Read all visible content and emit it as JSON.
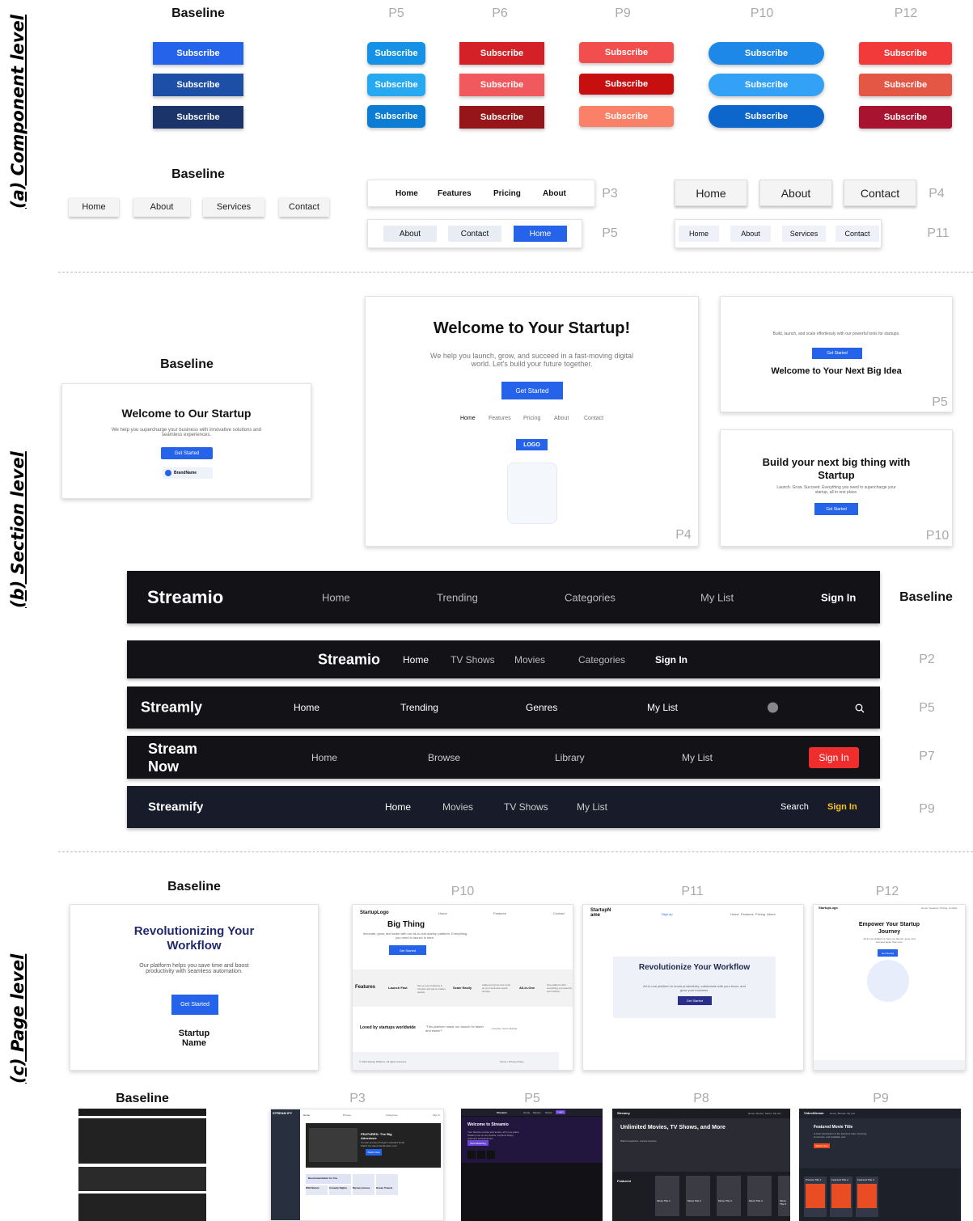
{
  "sections": {
    "a": "(a) Component level",
    "b": "(b) Section level",
    "c": "(c) Page level"
  },
  "a": {
    "buttons": {
      "headers": [
        "Baseline",
        "P5",
        "P6",
        "P9",
        "P10",
        "P12"
      ],
      "label": "Subscribe",
      "colors": {
        "baseline": [
          "#2563eb",
          "#1e4fa6",
          "#1b356b"
        ],
        "p5": [
          "#1592e6",
          "#27a9f2",
          "#0d7dd4"
        ],
        "p6": [
          "#d42128",
          "#f05a5f",
          "#951519"
        ],
        "p9": [
          "#f24e4e",
          "#c80f0f",
          "#fb8068"
        ],
        "p10": [
          "#1e88e8",
          "#33a1f5",
          "#0d66cc"
        ],
        "p12": [
          "#f23a3a",
          "#e35744",
          "#a8132f"
        ]
      }
    },
    "nav": {
      "header": "Baseline",
      "baseline": [
        "Home",
        "About",
        "Services",
        "Contact"
      ],
      "p3": {
        "label": "P3",
        "items": [
          "Home",
          "Features",
          "Pricing",
          "About"
        ]
      },
      "p4": {
        "label": "P4",
        "items": [
          "Home",
          "About",
          "Contact"
        ]
      },
      "p5": {
        "label": "P5",
        "items": [
          "About",
          "Contact",
          "Home"
        ]
      },
      "p11": {
        "label": "P11",
        "items": [
          "Home",
          "About",
          "Services",
          "Contact"
        ]
      }
    }
  },
  "b": {
    "hero": {
      "header": "Baseline",
      "baseline": {
        "title": "Welcome to Our Startup",
        "sub": "We help you supercharge your business with innovative solutions and seamless experiences.",
        "btn": "Get Started",
        "brand": "BrandName"
      },
      "p4": {
        "label": "P4",
        "title": "Welcome to Your Startup!",
        "sub": "We help you launch, grow, and succeed in a fast-moving digital world. Let's build your future together.",
        "btn": "Get Started",
        "nav": [
          "Home",
          "Features",
          "Pricing",
          "About",
          "Contact"
        ],
        "logo": "LOGO"
      },
      "p5": {
        "label": "P5",
        "sub": "Build, launch, and scale effortlessly with our powerful tools for startups.",
        "btn": "Get Started",
        "title": "Welcome to Your Next Big Idea"
      },
      "p10": {
        "label": "P10",
        "title": "Build your next big thing with Startup",
        "sub": "Launch. Grow. Succeed. Everything you need to supercharge your startup, all in one place.",
        "btn": "Get Started"
      }
    },
    "stream": {
      "baseline": {
        "label": "Baseline",
        "brand": "Streamio",
        "items": [
          "Home",
          "Trending",
          "Categories",
          "My List"
        ],
        "signin": "Sign In"
      },
      "p2": {
        "label": "P2",
        "brand": "Streamio",
        "items": [
          "Home",
          "TV Shows",
          "Movies",
          "Categories"
        ],
        "signin": "Sign In"
      },
      "p5": {
        "label": "P5",
        "brand": "Streamly",
        "items": [
          "Home",
          "Trending",
          "Genres",
          "My List"
        ]
      },
      "p7": {
        "label": "P7",
        "brand": "Stream Now",
        "items": [
          "Home",
          "Browse",
          "Library",
          "My List"
        ],
        "signin": "Sign In"
      },
      "p9": {
        "label": "P9",
        "brand": "Streamify",
        "items": [
          "Home",
          "Movies",
          "TV Shows",
          "My List"
        ],
        "search": "Search",
        "signin": "Sign In"
      }
    }
  },
  "c": {
    "row1": {
      "header": "Baseline",
      "baseline": {
        "title": "Revolutionizing Your Workflow",
        "sub": "Our platform helps you save time and boost productivity with seamless automation.",
        "btn": "Get Started",
        "footer": "Startup Name"
      },
      "p10": {
        "label": "P10",
        "logo": "StartupLogo",
        "nav": [
          "Home",
          "Features",
          "Contact"
        ],
        "title": "Big Thing",
        "sub": "Innovate, grow, and scale with our all-in-one-startup platform. Everything you need to launch is here.",
        "btn": "Get Started",
        "features": "Features",
        "f1": "Launch Fast",
        "f2": "Scale Easily",
        "f3": "All-in-One",
        "f1d": "Set up your business in minutes and get to market quickly.",
        "f2d": "Adapt and grow your tools as your business needs change.",
        "f3d": "One platform with everything you need for your startup.",
        "loved": "Loved by startups worldwide",
        "quote": "\"This platform made our launch 5x faster and easier!\"",
        "author": "– Founder, Acme Startup",
        "copy": "© 2024 Startup Platform. All rights reserved.",
        "links": "Terms • Privacy Policy"
      },
      "p11": {
        "label": "P11",
        "logo": "StartupN ame",
        "signup": "Sign up",
        "nav": "Home  Features  Pricing  About",
        "title": "Revolutionize Your Workflow",
        "sub": "All-in-one platform to boost productivity, collaborate with your team, and grow your business.",
        "btn": "Get Started"
      },
      "p12": {
        "label": "P12",
        "logo": "StartupLogo",
        "nav": "Home  Features  Pricing  Contact",
        "title": "Empower Your Startup Journey",
        "sub": "All-in-one platform to help you launch, grow, and succeed faster than ever.",
        "btn": "Get Started"
      }
    },
    "row2": {
      "header": "Baseline",
      "p3": {
        "label": "P3",
        "logo": "STREAM IFY",
        "nav": [
          "Home",
          "Browse",
          "Categories",
          "Sign In"
        ],
        "featured": "FEATURED: The Big Adventure",
        "featsub": "An epic journey through uncharted lands. Watch the latest blockbuster now!",
        "watch": "Watch Now",
        "rec": "Recommendation for You",
        "cards": [
          "Wild Nature",
          "Comedy Nights",
          "Mystery House",
          "Ocean Travels"
        ]
      },
      "p5": {
        "label": "P5",
        "logo": "Streamio",
        "nav": [
          "Home",
          "Movies",
          "Series",
          "Login"
        ],
        "title": "Welcome to Streamio",
        "sub": "Your favorite movies and series, all in one place. Stream now on any device, anytime! Enjoy unlimited entertainment.",
        "btn": "Start Watching"
      },
      "p8": {
        "label": "P8",
        "logo": "Streamy",
        "nav": "Home  Movies  Series  My List",
        "title": "Unlimited Movies, TV Shows, and More",
        "sub": "Watch anywhere. Cancel anytime.",
        "featured": "Featured",
        "items": [
          "Movie Title 1",
          "Movie Title 2",
          "Movie Title 3",
          "Movie Title 4",
          "Movie Title 5"
        ]
      },
      "p9": {
        "label": "P9",
        "logo": "VideoStream",
        "nav": "Home  Browse  My List",
        "title": "Featured Movie Title",
        "sub": "A short description of the featured video. Exciting, immersive, and available now.",
        "btn": "Watch Now",
        "items": [
          "Preview Title 1",
          "Featured Title 2",
          "Featured Title 3"
        ]
      }
    }
  }
}
